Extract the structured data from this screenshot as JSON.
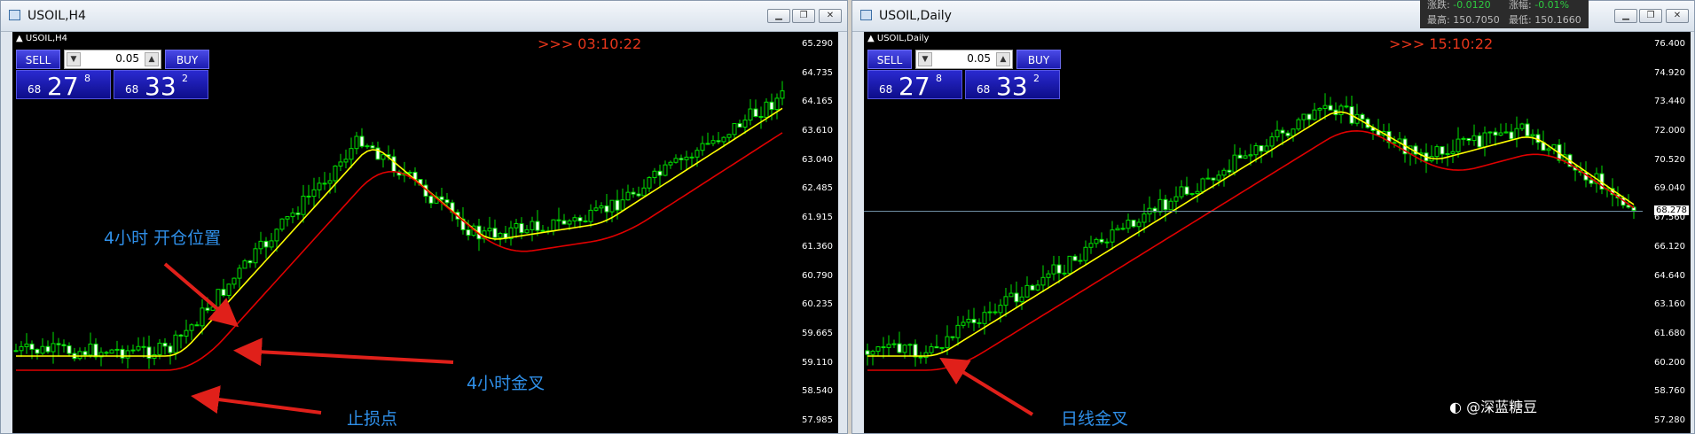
{
  "left": {
    "title": "USOIL,H4",
    "symbol_label": "USOIL,H4",
    "timer": ">>> 03:10:22",
    "sell_label": "SELL",
    "buy_label": "BUY",
    "lot_value": "0.05",
    "sell_small": "68",
    "sell_big": "27",
    "sell_sup": "8",
    "buy_small": "68",
    "buy_big": "33",
    "buy_sup": "2",
    "ticks": [
      "65.290",
      "64.735",
      "64.165",
      "63.610",
      "63.040",
      "62.485",
      "61.915",
      "61.360",
      "60.790",
      "60.235",
      "59.665",
      "59.110",
      "58.540",
      "57.985"
    ],
    "annotations": {
      "open_position": "4小时 开仓位置",
      "golden_cross": "4小时金叉",
      "stop_loss": "止损点"
    }
  },
  "right": {
    "title": "USOIL,Daily",
    "symbol_label": "USOIL,Daily",
    "timer": ">>> 15:10:22",
    "sell_label": "SELL",
    "buy_label": "BUY",
    "lot_value": "0.05",
    "sell_small": "68",
    "sell_big": "27",
    "sell_sup": "8",
    "buy_small": "68",
    "buy_big": "33",
    "buy_sup": "2",
    "ticks": [
      "76.400",
      "74.920",
      "73.440",
      "72.000",
      "70.520",
      "69.040",
      "67.560",
      "66.120",
      "64.640",
      "63.160",
      "61.680",
      "60.200",
      "58.760",
      "57.280"
    ],
    "current_price": "68.278",
    "annotations": {
      "daily_cross": "日线金叉"
    }
  },
  "tooltip": {
    "change_label": "涨跌:",
    "change_value": "-0.0120",
    "pct_label": "涨幅:",
    "pct_value": "-0.01%",
    "high_label": "最高:",
    "high_value": "150.7050",
    "low_label": "最低:",
    "low_value": "150.1660"
  },
  "watermark": "@深蓝糖豆",
  "colors": {
    "bull": "#00e000",
    "bear": "#ffffff",
    "ma_fast": "#ffff00",
    "ma_slow": "#e00000",
    "annotation_text": "#2f8fe8",
    "annotation_arrow": "#e0201a",
    "timer": "#e8361b"
  }
}
